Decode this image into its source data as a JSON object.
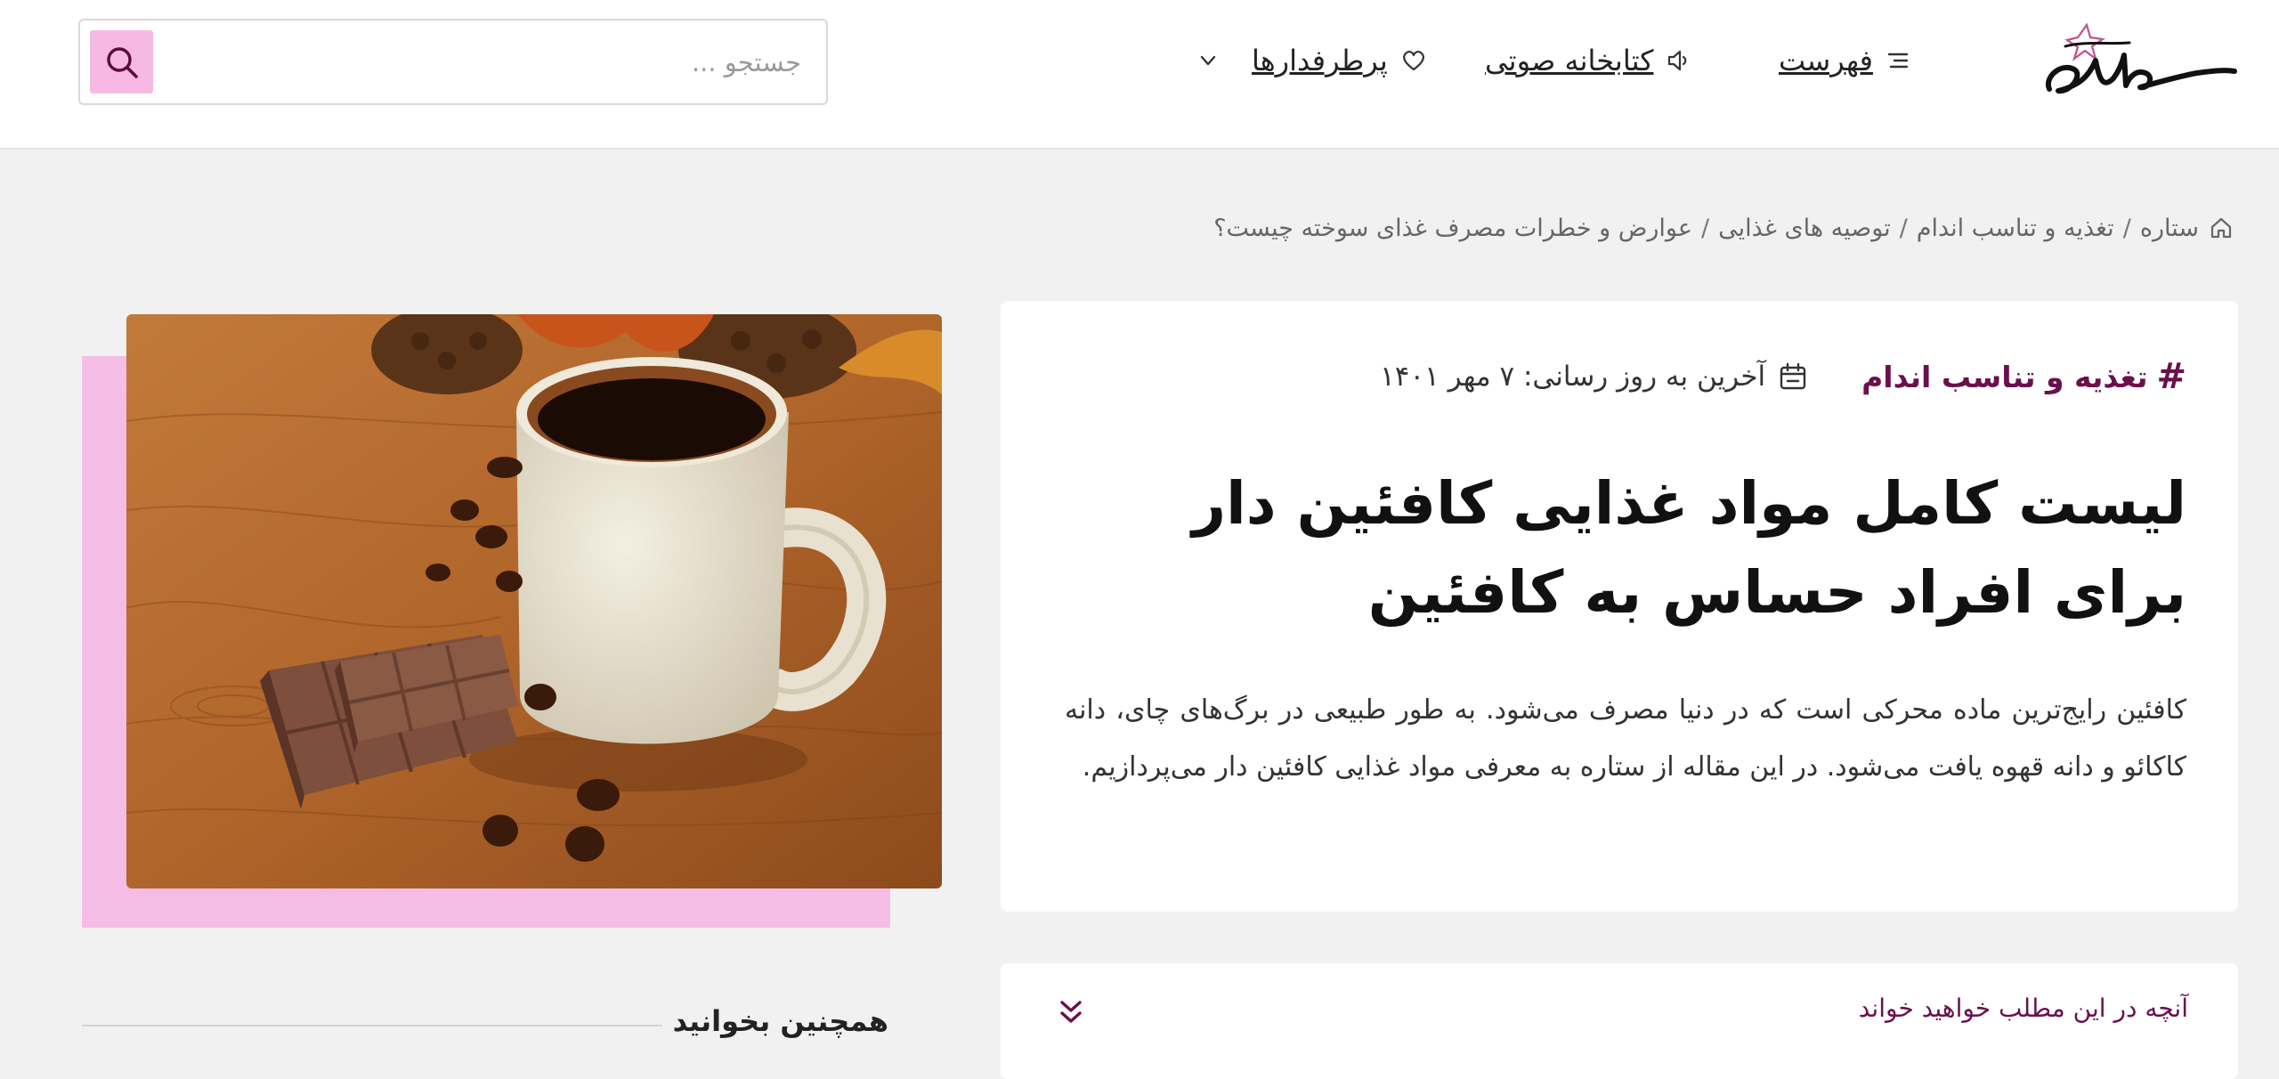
{
  "header": {
    "logo_text": "ستاره",
    "nav": {
      "menu_label": "فهرست",
      "audio_library_label": "کتابخانه صوتی",
      "popular_label": "پرطرفدارها"
    },
    "search": {
      "placeholder": "جستجو ..."
    }
  },
  "breadcrumb": {
    "items": [
      "ستاره",
      "تغذیه و تناسب اندام",
      "توصیه های غذایی",
      "عوارض و خطرات مصرف غذای سوخته چیست؟"
    ],
    "separator": "/"
  },
  "article": {
    "category": "تغذیه و تناسب اندام",
    "category_symbol": "#",
    "updated": "آخرین به روز رسانی: ۷ مهر ۱۴۰۱",
    "title": "لیست کامل مواد غذایی کافئین دار برای افراد حساس به کافئین",
    "intro": "کافئین رایج‌ترین ماده محرکی است که در دنیا مصرف می‌شود. به طور طبیعی در برگ‌های چای، دانه کاکائو و دانه قهوه  یافت می‌شود. در این مقاله از ستاره به معرفی مواد غذایی کافئین دار می‌پردازیم."
  },
  "toc": {
    "label": "آنچه در این مطلب خواهید خواند"
  },
  "sidebar": {
    "also_read": "همچنین بخوانید"
  },
  "colors": {
    "accent": "#6b0f4e",
    "pink": "#f5bde5",
    "page_bg": "#f1f1f1"
  }
}
